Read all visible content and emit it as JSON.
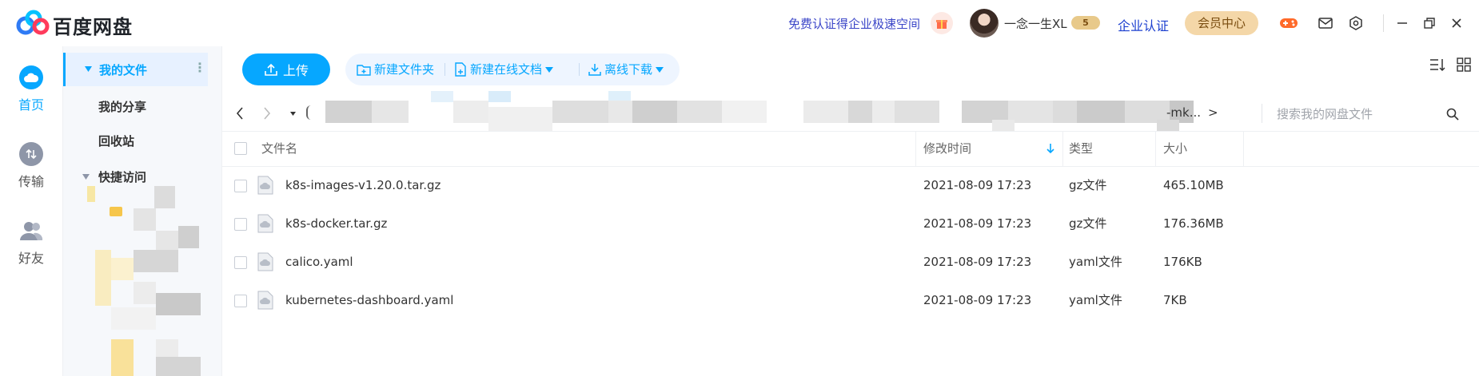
{
  "titlebar": {
    "brand": "百度网盘",
    "promo": "免费认证得企业极速空间",
    "username": "一念一生XL",
    "vip_badge": "5",
    "enterprise": "企业认证",
    "member_center": "会员中心"
  },
  "leftnav": [
    {
      "label": "首页",
      "icon": "cloud-icon",
      "active": true
    },
    {
      "label": "传输",
      "icon": "transfer-icon",
      "active": false
    },
    {
      "label": "好友",
      "icon": "friends-icon",
      "active": false
    }
  ],
  "sidebar": {
    "items": [
      {
        "label": "我的文件"
      },
      {
        "label": "我的分享"
      },
      {
        "label": "回收站"
      },
      {
        "label": "快捷访问"
      }
    ]
  },
  "toolbar": {
    "upload": "上传",
    "new_folder": "新建文件夹",
    "new_doc": "新建在线文档",
    "offline_download": "离线下载"
  },
  "path": {
    "tail": "-mk...",
    "next": ">"
  },
  "search": {
    "placeholder": "搜索我的网盘文件"
  },
  "table": {
    "columns": {
      "name": "文件名",
      "modified": "修改时间",
      "type": "类型",
      "size": "大小"
    },
    "rows": [
      {
        "name": "k8s-images-v1.20.0.tar.gz",
        "modified": "2021-08-09 17:23",
        "type": "gz文件",
        "size": "465.10MB"
      },
      {
        "name": "k8s-docker.tar.gz",
        "modified": "2021-08-09 17:23",
        "type": "gz文件",
        "size": "176.36MB"
      },
      {
        "name": "calico.yaml",
        "modified": "2021-08-09 17:23",
        "type": "yaml文件",
        "size": "176KB"
      },
      {
        "name": "kubernetes-dashboard.yaml",
        "modified": "2021-08-09 17:23",
        "type": "yaml文件",
        "size": "7KB"
      }
    ]
  },
  "colors": {
    "accent": "#06a7ff",
    "enterprise": "#1c3fcf",
    "member": "#f4d7a8"
  }
}
